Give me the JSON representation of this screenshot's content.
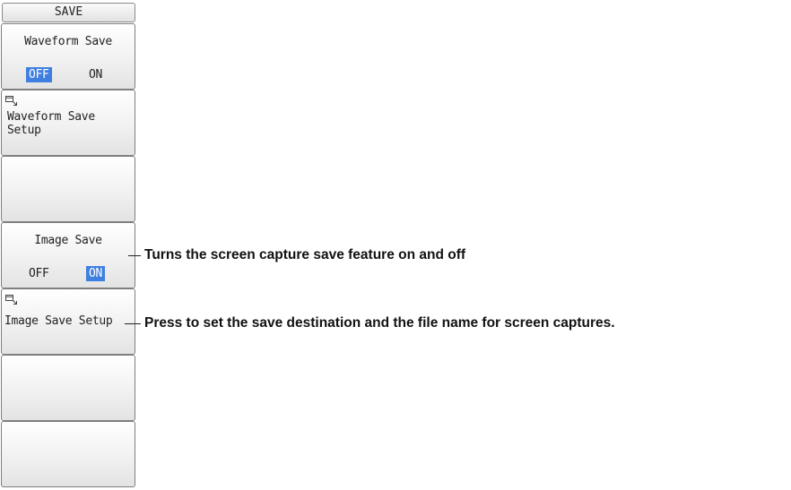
{
  "menu": {
    "title": "SAVE",
    "waveform_save": {
      "label": "Waveform Save",
      "off_label": "OFF",
      "on_label": "ON",
      "selected": "OFF"
    },
    "waveform_save_setup": {
      "label": "Waveform Save\nSetup",
      "icon": "setup-window-icon"
    },
    "image_save": {
      "label": "Image Save",
      "off_label": "OFF",
      "on_label": "ON",
      "selected": "ON"
    },
    "image_save_setup": {
      "label": "Image Save Setup",
      "icon": "setup-window-icon"
    }
  },
  "callouts": {
    "image_save": "Turns the screen capture save feature on and off",
    "image_save_setup": "Press to set the save destination and the file name for screen captures."
  },
  "colors": {
    "selected_bg": "#3f7fe0",
    "key_border": "#7f7f7f"
  }
}
